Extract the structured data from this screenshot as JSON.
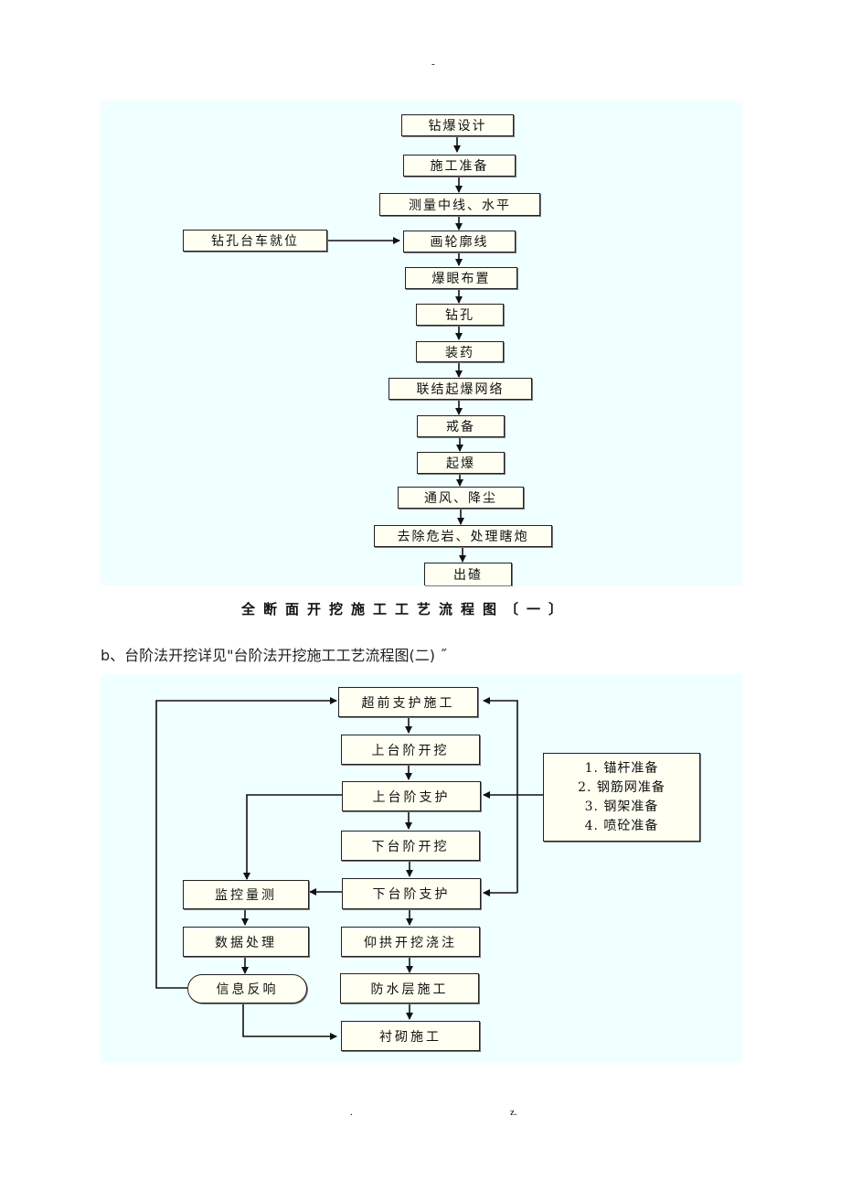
{
  "page": {
    "header_mark": "-",
    "footer_left": ".",
    "footer_right": "z."
  },
  "flowchart1": {
    "caption": "全断面开挖施工工艺流程图〔一〕",
    "side_input": "钻孔台车就位",
    "steps": [
      "钻爆设计",
      "施工准备",
      "测量中线、水平",
      "画轮廓线",
      "爆眼布置",
      "钻孔",
      "装药",
      "联结起爆网络",
      "戒备",
      "起爆",
      "通风、降尘",
      "去除危岩、处理瞎炮",
      "出碴"
    ]
  },
  "paragraph_b": "b、台阶法开挖详见\"台阶法开挖施工工艺流程图(二) ˝",
  "flowchart2": {
    "main_steps": [
      "超前支护施工",
      "上台阶开挖",
      "上台阶支护",
      "下台阶开挖",
      "下台阶支护",
      "仰拱开挖浇注",
      "防水层施工",
      "衬砌施工"
    ],
    "monitor_steps": [
      "监控量测",
      "数据处理",
      "信息反响"
    ],
    "preparation_list": [
      "1. 锚杆准备",
      "2.  钢筋网准备",
      "3. 钢架准备",
      "4. 喷砼准备"
    ]
  }
}
